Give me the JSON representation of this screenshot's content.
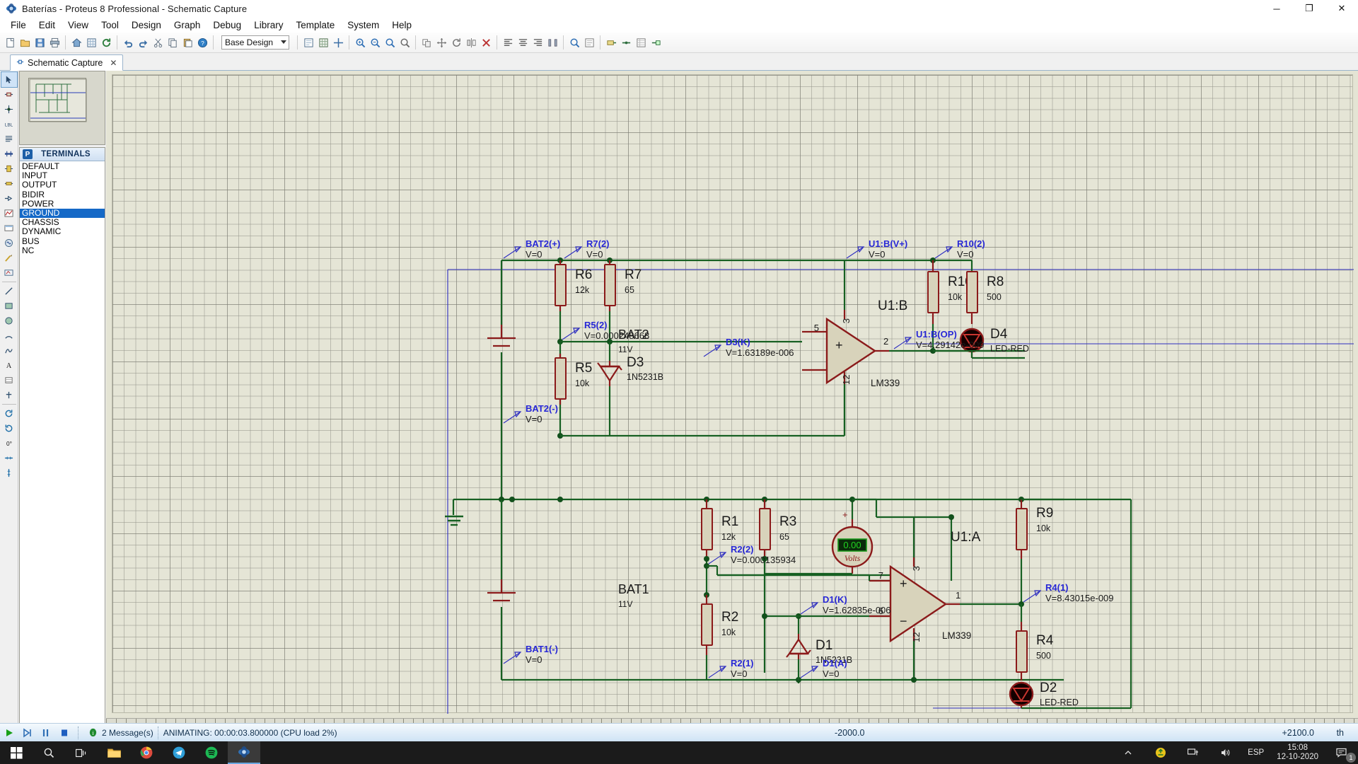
{
  "window": {
    "title": "Baterías - Proteus 8 Professional - Schematic Capture",
    "app_icon": "proteus-icon",
    "minimize": "─",
    "maximize": "❐",
    "close": "✕"
  },
  "menu": {
    "items": [
      "File",
      "Edit",
      "View",
      "Tool",
      "Design",
      "Graph",
      "Debug",
      "Library",
      "Template",
      "System",
      "Help"
    ]
  },
  "toolbar": {
    "groups": [
      [
        "new-file-icon",
        "open-folder-icon",
        "save-icon",
        "print-icon"
      ],
      [
        "home-icon",
        "grid-snap-icon",
        "refresh-icon"
      ],
      [
        "undo-icon",
        "redo-icon",
        "cut-icon",
        "copy-icon",
        "paste-icon",
        "help-icon"
      ]
    ],
    "design_selector": "Base Design",
    "design_options": [
      "Base Design"
    ],
    "icons_row2": [
      "sheet-icon",
      "grid-icon",
      "origin-icon",
      "zoom-fit-icon",
      "zoom-in-icon",
      "zoom-out-icon",
      "zoom-area-icon",
      "zoom-sheet-icon"
    ],
    "icons_row3": [
      "copy-block-icon",
      "move-block-icon",
      "rotate-block-icon",
      "mirror-block-icon",
      "delete-block-icon",
      "align-left-icon",
      "align-center-icon",
      "align-right-icon",
      "distribute-icon",
      "search-icon",
      "property-icon",
      "bom-icon"
    ],
    "icons_row4": [
      "wire-label-icon",
      "net-icon",
      "bus-icon",
      "terminal-icon"
    ]
  },
  "tabs": [
    {
      "label": "Schematic Capture",
      "icon": "schematic-icon",
      "close": "✕",
      "active": true
    }
  ],
  "left_tools": [
    "selection-mode-icon",
    "component-mode-icon",
    "junction-dot-icon",
    "wire-label-icon",
    "text-script-icon",
    "bus-icon",
    "subcircuit-icon",
    "terminals-mode-icon",
    "device-pin-icon",
    "graph-mode-icon",
    "tape-recorder-icon",
    "generator-icon",
    "voltage-probe-icon",
    "current-probe-icon",
    "virtual-instrument-icon",
    "line-icon",
    "box-icon",
    "circle-icon",
    "arc-icon",
    "path-icon",
    "text-icon",
    "symbol-icon",
    "marker-icon",
    "rotate-cw-icon",
    "rotate-ccw-icon",
    "mirror-x-icon",
    "mirror-y-icon"
  ],
  "object_selector": {
    "badge": "P",
    "title": "TERMINALS",
    "items": [
      "DEFAULT",
      "INPUT",
      "OUTPUT",
      "BIDIR",
      "POWER",
      "GROUND",
      "CHASSIS",
      "DYNAMIC",
      "BUS",
      "NC"
    ],
    "selected": "GROUND"
  },
  "schematic": {
    "components": [
      {
        "name": "BAT2",
        "value": "11V",
        "type": "battery"
      },
      {
        "name": "BAT1",
        "value": "11V",
        "type": "battery"
      },
      {
        "name": "R6",
        "value": "12k",
        "type": "resistor"
      },
      {
        "name": "R7",
        "value": "65",
        "type": "resistor"
      },
      {
        "name": "R5",
        "value": "10k",
        "type": "resistor"
      },
      {
        "name": "R10",
        "value": "10k",
        "type": "resistor"
      },
      {
        "name": "R8",
        "value": "500",
        "type": "resistor"
      },
      {
        "name": "R1",
        "value": "12k",
        "type": "resistor"
      },
      {
        "name": "R3",
        "value": "65",
        "type": "resistor"
      },
      {
        "name": "R2",
        "value": "10k",
        "type": "resistor"
      },
      {
        "name": "R9",
        "value": "10k",
        "type": "resistor"
      },
      {
        "name": "R4",
        "value": "500",
        "type": "resistor"
      },
      {
        "name": "D3",
        "value": "1N5231B",
        "type": "zener-diode"
      },
      {
        "name": "D1",
        "value": "1N5231B",
        "type": "zener-diode"
      },
      {
        "name": "D4",
        "value": "LED-RED",
        "type": "led"
      },
      {
        "name": "D2",
        "value": "LED-RED",
        "type": "led"
      },
      {
        "name": "U1:B",
        "value": "LM339",
        "type": "comparator"
      },
      {
        "name": "U1:A",
        "value": "LM339",
        "type": "comparator"
      }
    ],
    "probes": [
      {
        "label": "BAT2(+)",
        "value": "V=0"
      },
      {
        "label": "R7(2)",
        "value": "V=0"
      },
      {
        "label": "U1:B(V+)",
        "value": "V=0"
      },
      {
        "label": "R10(2)",
        "value": "V=0"
      },
      {
        "label": "R5(2)",
        "value": "V=0.000248668"
      },
      {
        "label": "D3(K)",
        "value": "V=1.63189e-006"
      },
      {
        "label": "U1:B(OP)",
        "value": "V=4.29142e-009"
      },
      {
        "label": "BAT2(-)",
        "value": "V=0"
      },
      {
        "label": "R2(2)",
        "value": "V=0.000135934"
      },
      {
        "label": "D1(K)",
        "value": "V=1.62835e-006"
      },
      {
        "label": "R4(1)",
        "value": "V=8.43015e-009"
      },
      {
        "label": "BAT1(-)",
        "value": "V=0"
      },
      {
        "label": "R2(1)",
        "value": "V=0"
      },
      {
        "label": "D1(A)",
        "value": "V=0"
      }
    ],
    "opamp_pins": {
      "u1b": {
        "plus": "5",
        "minus": "",
        "out": "2",
        "vcc": "3",
        "gnd": "12"
      },
      "u1a": {
        "plus": "7",
        "minus": "6",
        "out": "1",
        "vcc": "3",
        "gnd": "12"
      }
    },
    "voltmeter": {
      "reading": "0.00",
      "unit": "Volts",
      "plus": "+",
      "minus": "−"
    }
  },
  "statusbar": {
    "messages": "2 Message(s)",
    "animation": "ANIMATING: 00:00:03.800000 (CPU load 2%)",
    "coord_x": "-2000.0",
    "coord_y": "+2100.0",
    "units": "th",
    "buttons": [
      "play-icon",
      "step-icon",
      "pause-icon",
      "stop-icon"
    ]
  },
  "taskbar": {
    "start": "windows-start-icon",
    "items": [
      "search-icon",
      "task-view-icon",
      "file-explorer-icon",
      "chrome-icon",
      "telegram-icon",
      "spotify-icon",
      "proteus-icon"
    ],
    "tray": [
      "chevron-up-icon",
      "update-icon",
      "network-icon",
      "volume-icon"
    ],
    "language": "ESP",
    "time": "15:08",
    "date": "12-10-2020",
    "notifications": "1"
  }
}
